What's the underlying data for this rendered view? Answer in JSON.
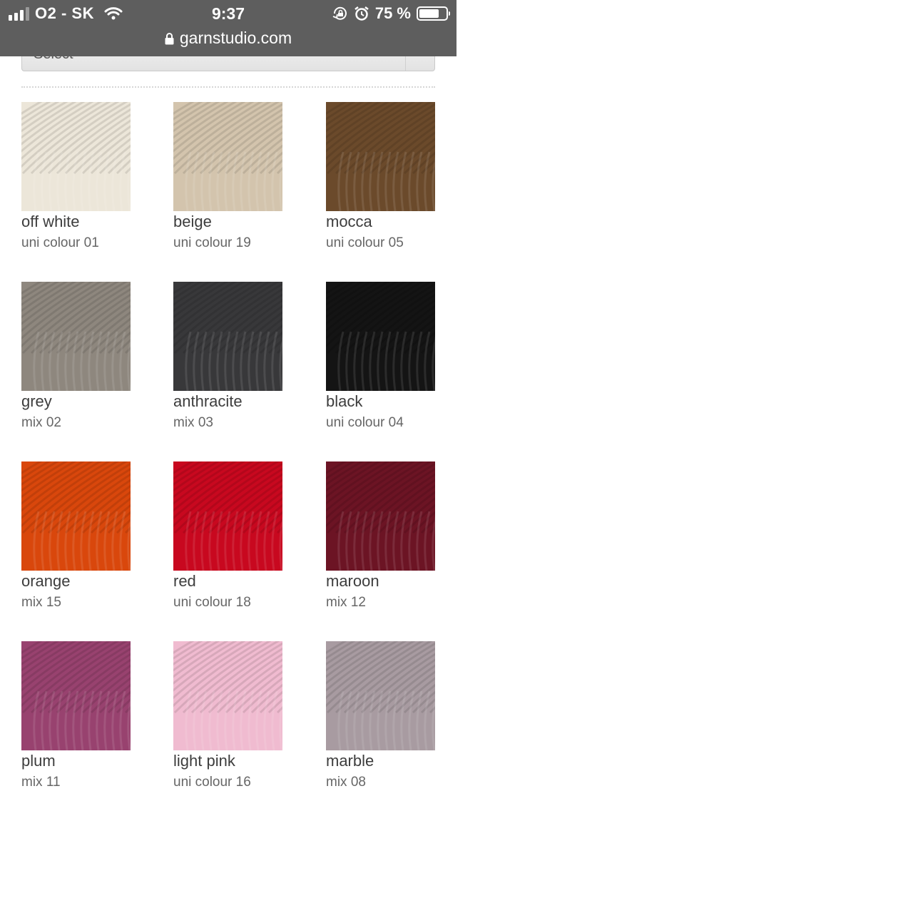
{
  "status_bar": {
    "carrier": "O2 - SK",
    "time": "9:37",
    "battery_percent": "75 %",
    "battery_level": 0.75,
    "signal_bars": 3,
    "icons": [
      "signal-icon",
      "wifi-icon",
      "rotation-lock-icon",
      "alarm-icon",
      "battery-icon"
    ]
  },
  "browser": {
    "url": "garnstudio.com",
    "url_icon": "lock-icon"
  },
  "select": {
    "label": "Select"
  },
  "colours": [
    {
      "name": "off white",
      "code": "uni colour 01",
      "color": "#ece6d9"
    },
    {
      "name": "beige",
      "code": "uni colour 19",
      "color": "#d3c4ad"
    },
    {
      "name": "mocca",
      "code": "uni colour 05",
      "color": "#6b4a2b"
    },
    {
      "name": "grey",
      "code": "mix 02",
      "color": "#8e877e"
    },
    {
      "name": "anthracite",
      "code": "mix 03",
      "color": "#38383a"
    },
    {
      "name": "black",
      "code": "uni colour 04",
      "color": "#141414"
    },
    {
      "name": "orange",
      "code": "mix 15",
      "color": "#d9470c"
    },
    {
      "name": "red",
      "code": "uni colour 18",
      "color": "#c8081f"
    },
    {
      "name": "maroon",
      "code": "mix 12",
      "color": "#6c1424"
    },
    {
      "name": "plum",
      "code": "mix 11",
      "color": "#98426f"
    },
    {
      "name": "light pink",
      "code": "uni colour 16",
      "color": "#f0bbd0"
    },
    {
      "name": "marble",
      "code": "mix 08",
      "color": "#a89ba1"
    }
  ]
}
